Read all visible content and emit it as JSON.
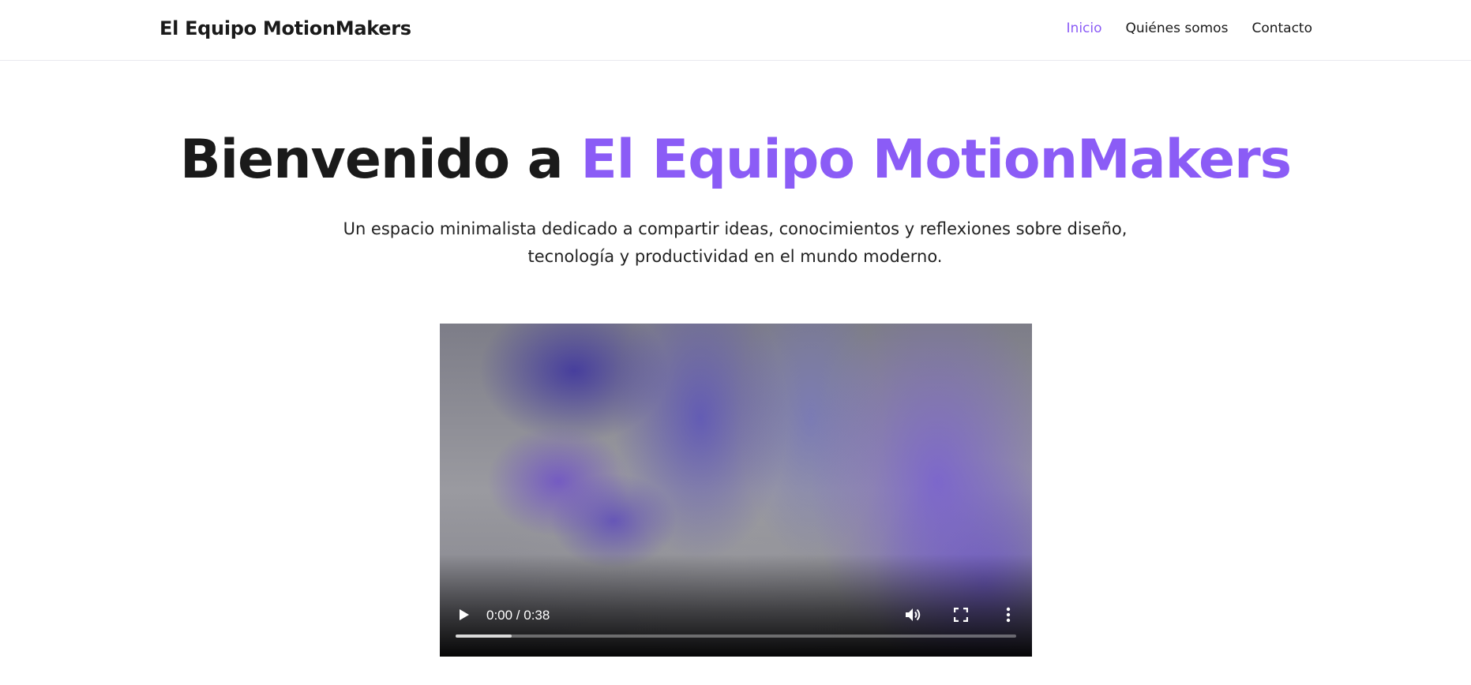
{
  "nav": {
    "brand": "El Equipo MotionMakers",
    "links": [
      {
        "label": "Inicio",
        "active": true
      },
      {
        "label": "Quiénes somos",
        "active": false
      },
      {
        "label": "Contacto",
        "active": false
      }
    ]
  },
  "hero": {
    "title_prefix": "Bienvenido a ",
    "title_accent": "El Equipo MotionMakers",
    "subtitle_line1": "Un espacio minimalista dedicado a compartir ideas, conocimientos y reflexiones sobre diseño,",
    "subtitle_line2": "tecnología y productividad en el mundo moderno."
  },
  "video": {
    "time_display": "0:00 / 0:38",
    "buffered_fraction": 0.1,
    "icons": [
      "play-icon",
      "volume-icon",
      "fullscreen-icon",
      "more-vert-icon"
    ]
  },
  "colors": {
    "accent": "#8b5cf6",
    "text": "#1a1a1a"
  }
}
